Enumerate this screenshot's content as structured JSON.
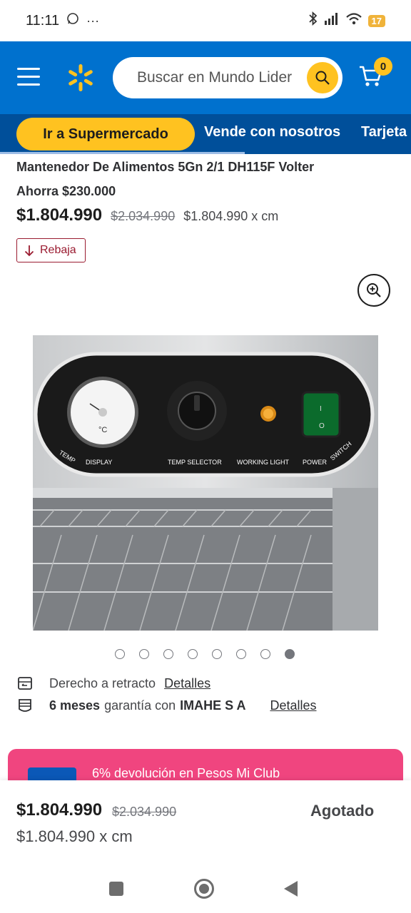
{
  "status_bar": {
    "time": "11:11",
    "battery": "17"
  },
  "header": {
    "search_placeholder": "Buscar en Mundo Lider",
    "cart_count": "0",
    "brand_color": "#0071ce",
    "accent_color": "#ffc220"
  },
  "nav": {
    "primary_pill": "Ir a Supermercado",
    "links": [
      "Vende con nosotros",
      "Tarjeta"
    ]
  },
  "product": {
    "title": "Mantenedor De Alimentos 5Gn 2/1 DH115F Volter",
    "savings": "Ahorra $230.000",
    "price": "$1.804.990",
    "old_price": "$2.034.990",
    "unit_price": "$1.804.990 x cm",
    "badge": "Rebaja"
  },
  "image_labels": {
    "temp": "TEMP",
    "display": "DISPLAY",
    "temp_selector": "TEMP SELECTOR",
    "working_light": "WORKING LIGHT",
    "power": "POWER",
    "switch": "SWITCH",
    "celsius": "°C"
  },
  "carousel": {
    "count": 8,
    "active_index": 7
  },
  "info": {
    "retract_label": "Derecho a retracto",
    "retract_link": "Detalles",
    "warranty_duration": "6 meses",
    "warranty_text": "garantía con",
    "warranty_provider": "IMAHE S A",
    "warranty_link": "Detalles"
  },
  "promo": {
    "text": "6% devolución en Pesos Mi Club"
  },
  "bottom_bar": {
    "price": "$1.804.990",
    "old_price": "$2.034.990",
    "unit_price": "$1.804.990 x cm",
    "status": "Agotado"
  }
}
